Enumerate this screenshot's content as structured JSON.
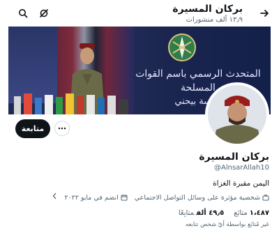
{
  "header": {
    "name": "بركان المسيرة",
    "posts_count": "١٣٫٩ ألف منشورات"
  },
  "banner": {
    "slogan_line1": "المتحدث الرسمي باسم القوات المسلحة",
    "slogan_line2": "العسة بيحني"
  },
  "actions": {
    "follow_label": "متابعة",
    "more_label": "•••"
  },
  "profile": {
    "display_name": "بركان المسيرة",
    "handle": "@AlnsarAllah10",
    "bio": "اليمن مقبرة الغزاة",
    "category": "شخصية مؤثرة على وسائل التواصل الاجتماعي",
    "joined": "انضم في مايو ٢٠٢٢",
    "following_count": "١،٤٨٧",
    "following_label": "متابَع",
    "followers_count": "٤٩٫٥ ألف",
    "followers_label": "متابِعًا",
    "followers_note": "غير مُتابَع بواسطة أيّ شخص تتابعه"
  },
  "colors": {
    "primary_text": "#0f1419",
    "secondary_text": "#536471",
    "follow_bg": "#0f1419",
    "banner_bg": "#1e2a52"
  },
  "icons": [
    "back-arrow-icon",
    "search-icon",
    "grok-icon",
    "more-icon",
    "verified-shield-icon",
    "briefcase-icon",
    "calendar-icon"
  ]
}
